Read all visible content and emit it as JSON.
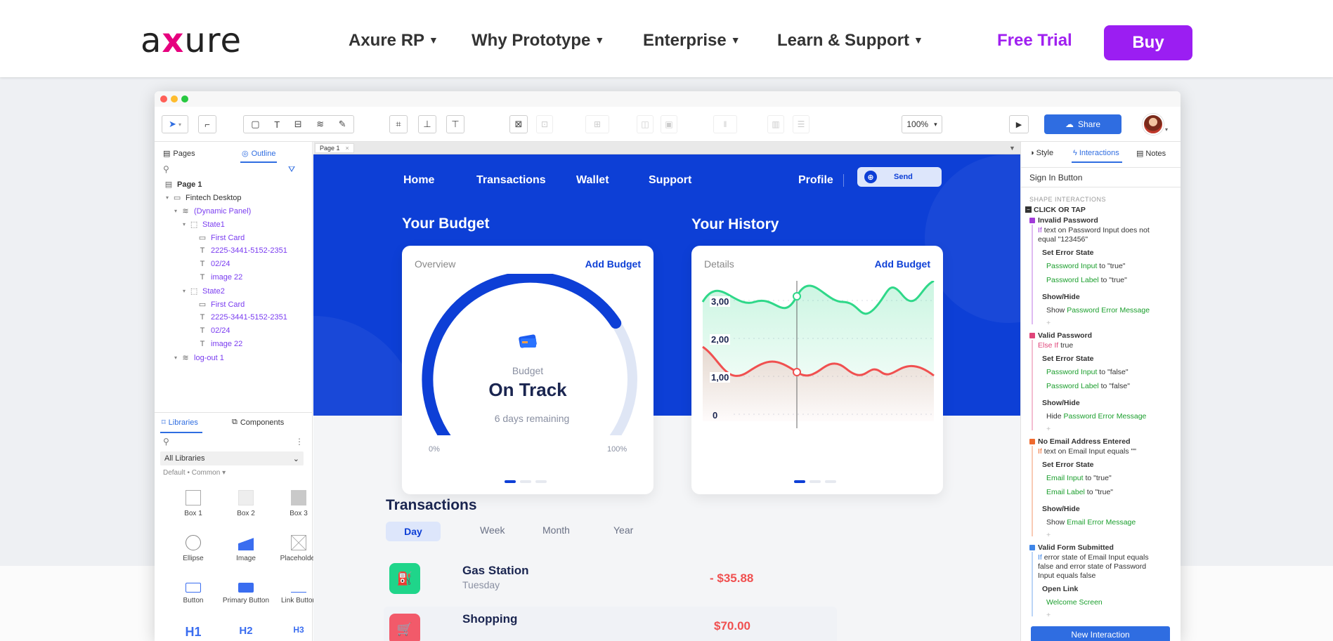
{
  "site": {
    "logo_left": "a",
    "logo_x": "x",
    "logo_right": "ure",
    "nav": [
      "Axure RP",
      "Why Prototype",
      "Enterprise",
      "Learn & Support"
    ],
    "caret": "▼",
    "free_trial": "Free Trial",
    "buy": "Buy"
  },
  "toolbar": {
    "zoom": "100%",
    "share": "Share"
  },
  "left_panel": {
    "tab_pages": "Pages",
    "tab_outline": "Outline",
    "outline": [
      {
        "label": "Page 1",
        "icon": "page-icon",
        "indent": 0,
        "purple": false,
        "bold": true
      },
      {
        "label": "Fintech Desktop",
        "icon": "folder-icon",
        "indent": 1,
        "purple": false,
        "bold": false
      },
      {
        "label": "(Dynamic Panel)",
        "icon": "layers-icon",
        "indent": 2,
        "purple": true,
        "bold": false
      },
      {
        "label": "State1",
        "icon": "state-icon",
        "indent": 3,
        "purple": true,
        "bold": false
      },
      {
        "label": "First Card",
        "icon": "rect-icon",
        "indent": 4,
        "purple": true,
        "bold": false
      },
      {
        "label": "2225-3441-5152-2351",
        "icon": "text-icon",
        "indent": 4,
        "purple": true,
        "bold": false
      },
      {
        "label": "02/24",
        "icon": "text-icon",
        "indent": 4,
        "purple": true,
        "bold": false
      },
      {
        "label": "image 22",
        "icon": "text-icon",
        "indent": 4,
        "purple": true,
        "bold": false
      },
      {
        "label": "State2",
        "icon": "state-icon",
        "indent": 3,
        "purple": true,
        "bold": false
      },
      {
        "label": "First Card",
        "icon": "rect-icon",
        "indent": 4,
        "purple": true,
        "bold": false
      },
      {
        "label": "2225-3441-5152-2351",
        "icon": "text-icon",
        "indent": 4,
        "purple": true,
        "bold": false
      },
      {
        "label": "02/24",
        "icon": "text-icon",
        "indent": 4,
        "purple": true,
        "bold": false
      },
      {
        "label": "image 22",
        "icon": "text-icon",
        "indent": 4,
        "purple": true,
        "bold": false
      },
      {
        "label": "log-out 1",
        "icon": "layers-icon",
        "indent": 2,
        "purple": true,
        "bold": false
      }
    ],
    "tab_libraries": "Libraries",
    "tab_components": "Components",
    "library_select": "All Libraries",
    "library_path": "Default • Common ▾",
    "widgets": [
      "Box 1",
      "Box 2",
      "Box 3",
      "Ellipse",
      "Image",
      "Placeholder",
      "Button",
      "Primary Button",
      "Link Button",
      "H1",
      "H2",
      "H3"
    ]
  },
  "canvas": {
    "page_tab": "Page 1",
    "nav": [
      "Home",
      "Transactions",
      "Wallet",
      "Support"
    ],
    "profile": "Profile",
    "send": "Send",
    "budget_heading": "Your Budget",
    "history_heading": "Your History",
    "budget_card": {
      "title": "Overview",
      "link": "Add Budget",
      "label": "Budget",
      "status": "On Track",
      "remaining": "6 days remaining",
      "min_label": "0%",
      "max_label": "100%",
      "progress": 0.72
    },
    "history_card": {
      "title": "Details",
      "link": "Add Budget",
      "y_labels": [
        "3,00",
        "2,00",
        "1,00",
        "0"
      ]
    },
    "transactions_heading": "Transactions",
    "tx_tabs": [
      "Day",
      "Week",
      "Month",
      "Year"
    ],
    "transactions": [
      {
        "name": "Gas Station",
        "sub": "Tuesday",
        "amount": "- $35.88",
        "color": "#1fd58a"
      },
      {
        "name": "Shopping",
        "sub": "",
        "amount": "$70.00",
        "color": "#f25a6a"
      }
    ]
  },
  "right_panel": {
    "tab_style": "Style",
    "tab_interactions": "Interactions",
    "tab_notes": "Notes",
    "selected": "Sign In Button",
    "section": "SHAPE INTERACTIONS",
    "event": "CLICK OR TAP",
    "cases": [
      {
        "name": "Invalid Password",
        "color": "#a23bd9",
        "cond_kw": "If",
        "cond": " text on Password Input does not",
        "cond2": "equal \"123456\"",
        "actions": [
          {
            "title": "Set Error State",
            "lines": [
              [
                "Password Input",
                " to \"true\""
              ],
              [
                "Password Label",
                " to \"true\""
              ]
            ]
          },
          {
            "title": "Show/Hide",
            "lines": [
              [
                "Show ",
                "Password Error Message"
              ]
            ]
          }
        ]
      },
      {
        "name": "Valid Password",
        "color": "#e0457a",
        "cond_kw": "Else If",
        "cond": " true",
        "cond2": "",
        "actions": [
          {
            "title": "Set Error State",
            "lines": [
              [
                "Password Input",
                " to \"false\""
              ],
              [
                "Password Label",
                " to \"false\""
              ]
            ]
          },
          {
            "title": "Show/Hide",
            "lines": [
              [
                "Hide ",
                "Password Error Message"
              ]
            ]
          }
        ]
      },
      {
        "name": "No Email Address Entered",
        "color": "#ef6a2f",
        "cond_kw": "If",
        "cond": " text on Email Input equals \"\"",
        "cond2": "",
        "actions": [
          {
            "title": "Set Error State",
            "lines": [
              [
                "Email Input",
                " to \"true\""
              ],
              [
                "Email Label",
                " to \"true\""
              ]
            ]
          },
          {
            "title": "Show/Hide",
            "lines": [
              [
                "Show ",
                "Email Error Message"
              ]
            ]
          }
        ]
      },
      {
        "name": "Valid Form Submitted",
        "color": "#3f86e8",
        "cond_kw": "If",
        "cond": " error state of Email Input equals",
        "cond2": "false and error state of Password",
        "cond3": "Input equals false",
        "actions": [
          {
            "title": "Open Link",
            "lines": [
              [
                "",
                "Welcome Screen"
              ]
            ]
          }
        ]
      }
    ],
    "new_interaction": "New Interaction"
  }
}
